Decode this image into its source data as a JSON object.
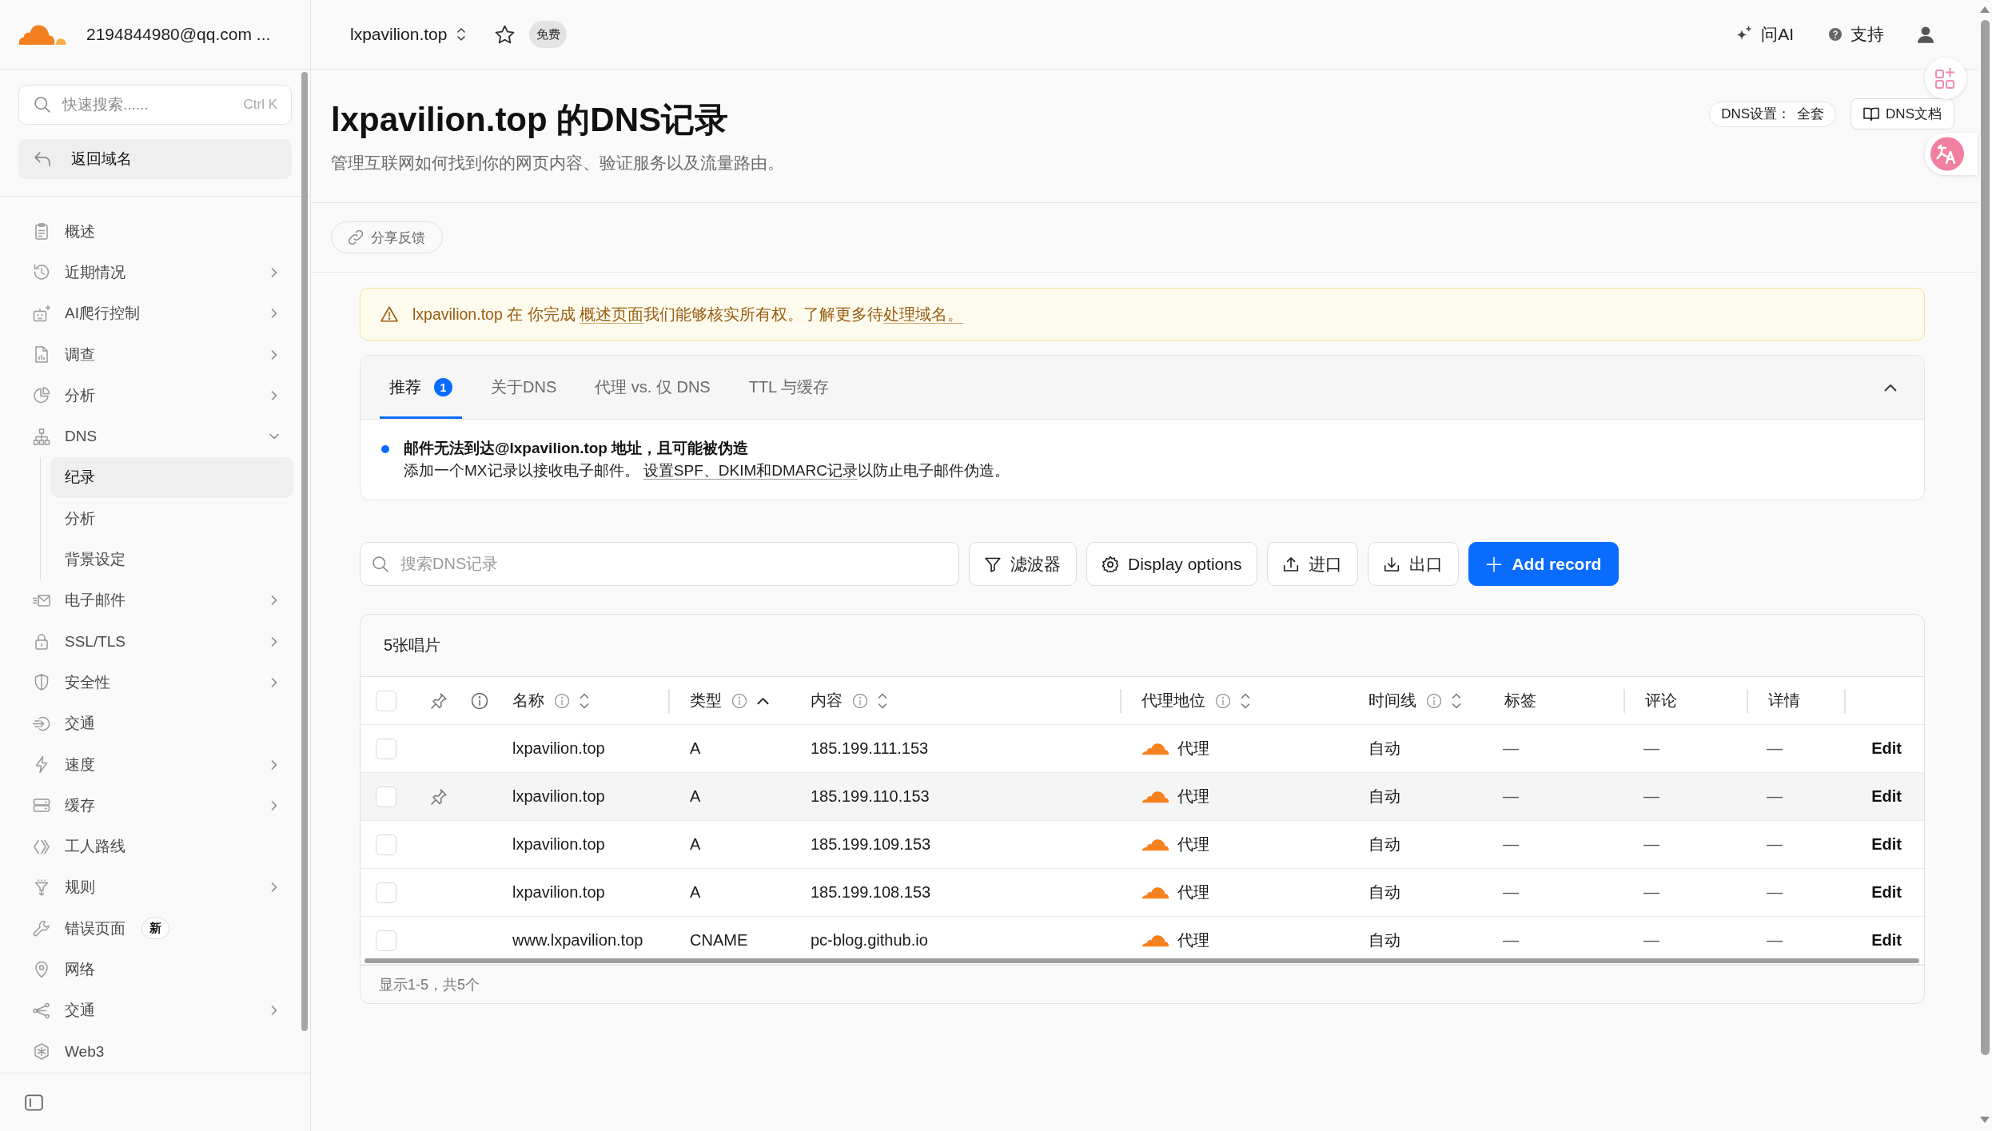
{
  "sidebar": {
    "account": "2194844980@qq.com ...",
    "search": {
      "placeholder": "快速搜索......",
      "shortcut": "Ctrl K"
    },
    "back_button": "返回域名",
    "items": [
      {
        "label": "概述",
        "selected": false
      },
      {
        "label": "近期情况",
        "selected": false,
        "expanded": false
      },
      {
        "label": "AI爬行控制",
        "selected": false,
        "expanded": false
      },
      {
        "label": "调查",
        "selected": false,
        "expanded": false
      },
      {
        "label": "分析",
        "selected": false,
        "expanded": false
      },
      {
        "label": "DNS",
        "selected": false,
        "expanded": true,
        "children": [
          {
            "label": "纪录",
            "selected": true
          },
          {
            "label": "分析",
            "selected": false
          },
          {
            "label": "背景设定",
            "selected": false
          }
        ]
      },
      {
        "label": "电子邮件",
        "selected": false,
        "expanded": false
      },
      {
        "label": "SSL/TLS",
        "selected": false,
        "expanded": false
      },
      {
        "label": "安全性",
        "selected": false,
        "expanded": false
      },
      {
        "label": "交通",
        "selected": false
      },
      {
        "label": "速度",
        "selected": false,
        "expanded": false
      },
      {
        "label": "缓存",
        "selected": false,
        "expanded": false
      },
      {
        "label": "工人路线",
        "selected": false
      },
      {
        "label": "规则",
        "selected": false,
        "expanded": false
      },
      {
        "label": "错误页面",
        "selected": false,
        "badge": "新"
      },
      {
        "label": "网络",
        "selected": false
      },
      {
        "label": "交通",
        "selected": false,
        "expanded": false
      },
      {
        "label": "Web3",
        "selected": false
      }
    ]
  },
  "top_bar": {
    "zone": "lxpavilion.top",
    "favorite": false,
    "plan_badge": "免费",
    "ask_ai": "问AI",
    "support": "支持"
  },
  "header": {
    "title": "lxpavilion.top 的DNS记录",
    "subtitle": "管理互联网如何找到你的网页内容、验证服务以及流量路由。",
    "dns_setup": {
      "label": "DNS设置：",
      "value": "全套"
    },
    "docs_button": "DNS文档"
  },
  "feedback_button": "分享反馈",
  "banner": {
    "parts": [
      {
        "kind": "text",
        "text": "lxpavilion.top 在 你完成 "
      },
      {
        "kind": "link",
        "text": "概述页面"
      },
      {
        "kind": "text",
        "text": "我们能够核实所有权。了解更多待"
      },
      {
        "kind": "link",
        "text": "处理域名。"
      }
    ]
  },
  "info_panel": {
    "expanded": true,
    "tabs": [
      {
        "label": "推荐",
        "selected": true,
        "count": "1"
      },
      {
        "label": "关于DNS",
        "selected": false
      },
      {
        "label": "代理 vs. 仅 DNS",
        "selected": false
      },
      {
        "label": "TTL 与缓存",
        "selected": false
      }
    ],
    "recommendations": [
      {
        "title": "邮件无法到达@lxpavilion.top 地址，且可能被伪造",
        "parts": [
          {
            "kind": "text",
            "text": "添加一个MX记录以接收电子邮件。 "
          },
          {
            "kind": "link",
            "text": "设置SPF、DKIM和DMARC记录"
          },
          {
            "kind": "text",
            "text": "以防止电子邮件伪造。"
          }
        ]
      }
    ]
  },
  "toolbar": {
    "search_placeholder": "搜索DNS记录",
    "buttons": [
      {
        "label": "滤波器",
        "kind": "filter"
      },
      {
        "label": "Display options",
        "kind": "settings"
      },
      {
        "label": "进口",
        "kind": "import"
      },
      {
        "label": "出口",
        "kind": "export"
      },
      {
        "label": "Add record",
        "kind": "add"
      }
    ]
  },
  "table": {
    "title": "5张唱片",
    "all_checked": false,
    "columns": [
      {
        "label": "名称",
        "info_icon": true,
        "sortable": true,
        "sorted_ascending": false
      },
      {
        "label": "类型",
        "info_icon": true,
        "sortable": true,
        "sorted_ascending": true
      },
      {
        "label": "内容",
        "info_icon": true,
        "sortable": true,
        "sorted_ascending": false
      },
      {
        "label": "代理地位",
        "info_icon": true,
        "sortable": true,
        "sorted_ascending": false
      },
      {
        "label": "时间线",
        "info_icon": true,
        "sortable": true,
        "sorted_ascending": false
      },
      {
        "label": "标签",
        "info_icon": false,
        "sortable": false,
        "sorted_ascending": false
      },
      {
        "label": "评论",
        "info_icon": false,
        "sortable": false,
        "sorted_ascending": false
      },
      {
        "label": "详情",
        "info_icon": false,
        "sortable": false,
        "sorted_ascending": false
      }
    ],
    "rows": [
      {
        "checked": false,
        "hovered": false,
        "name": "lxpavilion.top",
        "type": "A",
        "content": "185.199.111.153",
        "proxied": true,
        "proxy_status": "代理",
        "ttl": "自动",
        "tags": "—",
        "comments": "—",
        "details": "—",
        "action": "Edit"
      },
      {
        "checked": false,
        "hovered": true,
        "name": "lxpavilion.top",
        "type": "A",
        "content": "185.199.110.153",
        "proxied": true,
        "proxy_status": "代理",
        "ttl": "自动",
        "tags": "—",
        "comments": "—",
        "details": "—",
        "action": "Edit"
      },
      {
        "checked": false,
        "hovered": false,
        "name": "lxpavilion.top",
        "type": "A",
        "content": "185.199.109.153",
        "proxied": true,
        "proxy_status": "代理",
        "ttl": "自动",
        "tags": "—",
        "comments": "—",
        "details": "—",
        "action": "Edit"
      },
      {
        "checked": false,
        "hovered": false,
        "name": "lxpavilion.top",
        "type": "A",
        "content": "185.199.108.153",
        "proxied": true,
        "proxy_status": "代理",
        "ttl": "自动",
        "tags": "—",
        "comments": "—",
        "details": "—",
        "action": "Edit"
      },
      {
        "checked": false,
        "hovered": false,
        "name": "www.lxpavilion.top",
        "type": "CNAME",
        "content": "pc-blog.github.io",
        "proxied": true,
        "proxy_status": "代理",
        "ttl": "自动",
        "tags": "—",
        "comments": "—",
        "details": "—",
        "action": "Edit"
      }
    ],
    "footer": "显示1-5，共5个"
  }
}
